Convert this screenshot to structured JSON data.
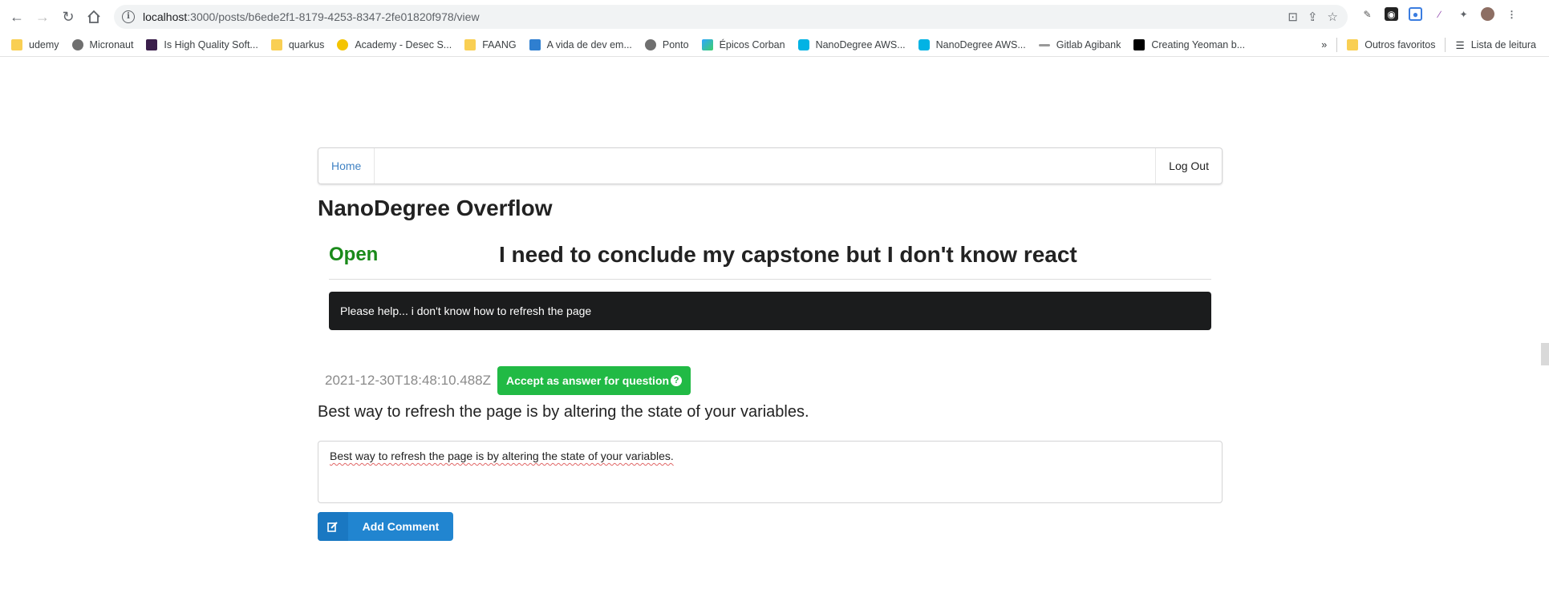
{
  "browser": {
    "url_host": "localhost",
    "url_rest": ":3000/posts/b6ede2f1-8179-4253-8347-2fe01820f978/view",
    "bookmarks": [
      {
        "label": "udemy",
        "icon": "folder"
      },
      {
        "label": "Micronaut",
        "icon": "globe"
      },
      {
        "label": "Is High Quality Soft...",
        "icon": "fowler-icon"
      },
      {
        "label": "quarkus",
        "icon": "folder"
      },
      {
        "label": "Academy - Desec S...",
        "icon": "desec-icon"
      },
      {
        "label": "FAANG",
        "icon": "folder"
      },
      {
        "label": "A vida de dev em...",
        "icon": "gf-icon"
      },
      {
        "label": "Ponto",
        "icon": "globe"
      },
      {
        "label": "Épicos Corban",
        "icon": "corban-icon"
      },
      {
        "label": "NanoDegree AWS...",
        "icon": "udacity-icon"
      },
      {
        "label": "NanoDegree AWS...",
        "icon": "udacity-icon"
      },
      {
        "label": "Gitlab Agibank",
        "icon": "gitlab-icon"
      },
      {
        "label": "Creating Yeoman b...",
        "icon": "dev-icon"
      }
    ],
    "more_label": "»",
    "other_favorites": "Outros favoritos",
    "reading_list": "Lista de leitura"
  },
  "nav": {
    "home": "Home",
    "logout": "Log Out"
  },
  "site_title": "NanoDegree Overflow",
  "question": {
    "status": "Open",
    "status_color": "#1a8a1a",
    "title": "I need to conclude my capstone but I don't know react",
    "body": "Please help... i don't know how to refresh the page"
  },
  "answer": {
    "timestamp": "2021-12-30T18:48:10.488Z",
    "accept_label": "Accept as answer for question",
    "text": "Best way to refresh the page is by altering the state of your variables."
  },
  "comment": {
    "value": "Best way to refresh the page is by altering the state of your variables.",
    "button_label": "Add Comment"
  }
}
